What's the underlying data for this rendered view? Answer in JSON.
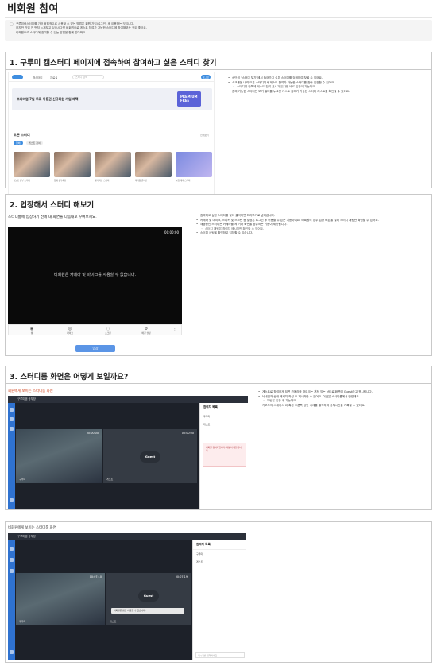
{
  "page": {
    "title": "비회원 참여",
    "callout": [
      "구루미캠스터디를 가장 효율적으로 사용할 수 있는 방법은 회원 가입(로그인) 후 이용하는 것입니다.",
      "하지만 가입 전 먼저 느껴보고 싶으시다면 비회원으로 게스트 참여가 가능한 스터디에 참여해보는 것도 좋아요.",
      "비회원으로 스터디에 참여할 수 있는 방법을 함께 알아봐요."
    ]
  },
  "section1": {
    "heading": "1. 구루미 캠스터디 페이지에 접속하여 참여하고 싶은 스터디 찾기",
    "site": {
      "nav": [
        "캠스터디",
        "자료실"
      ],
      "search_placeholder": "스터디 검색",
      "login": "로그인",
      "banner": "프리미엄 7일 무료 이용권 신규회원 가입 혜택",
      "premium": "PREMIUM FREE",
      "study_heading": "오픈 스터디",
      "study_more": "전체보기",
      "chips": [
        "전체",
        "게스트 참여"
      ],
      "thumb_captions": [
        "오늘도 공부 스터디",
        "함께 공부해요",
        "새벽 기상 스터디",
        "자격증 준비반",
        "시험 대비 스터디"
      ]
    },
    "bullets": [
      "상단의 \"스터디 찾기\"에서 들어가고 싶은 스터디를 검색하여 찾을 수 있어요.",
      "스크롤을 내려 오픈 스터디에서 게스트 참여가 가능한 스터디를 찾아 입장할 수 있어요.",
      "스터디명 안쪽에 게스트 참여 표시가 있다면 바로 입장이 가능해요.",
      "참여 가능한 스터디만 보기 필터를 누르면 게스트 참여가 가능한 스터디 리스트를 확인할 수 있어요."
    ]
  },
  "section2": {
    "heading": "2. 입장해서 스터디 해보기",
    "cam_heading": "스터디룸에 입장하기 전에 내 화면을 다음대로 꾸며보세요.",
    "timer": "00:00:00",
    "camera_msg": "비회원은 카메라 및 마이크를 사용할 수 없습니다.",
    "controls": [
      "캠",
      "마이크",
      "스크린",
      "배경 설정"
    ],
    "enter": "입장",
    "bullets": [
      "참여하고 싶은 스터디를 찾아 클릭하면 미리보기로 넘어갑니다.",
      "카메라 및 마이크, 스피커 및 스크린 등 설정은 로그인 후 이용할 수 있는 기능이에요. 비회원의 경우 입장 버튼을 눌러 스터디 채팅만 확인할 수 있어요.",
      "재생중인 스터디는 카메라를 켜 거나 화면을 공유하는 기능이 제한됩니다.",
      "스터디 채팅은 참여자 메시지만 확인할 수 있어요.",
      "스터디 세팅을 확인하고 입장할 수 있습니다."
    ]
  },
  "section3": {
    "heading": "3. 스터디룸 화면은 어떻게 보일까요?",
    "sublabel": "회원에게 보이는 스터디룸 화면",
    "app_title": "구루미캠 공부방",
    "timer_left": "00:00:00",
    "timer_right": "00:00:00",
    "guest": "Guest",
    "panel_title": "참여자 목록",
    "participants": [
      "구루미",
      "게스트"
    ],
    "warning": "비회원 참여자입니다. 채팅이 제한됩니다.",
    "bullets": [
      "게스트로 참여하게 되면 카메라와 마이크는 꺼져 있는 상태로 화면에 Guest라고 표시됩니다.",
      "닉네임과 상태 메세지 작성 후 재시작할 수 있어요. 이것은 스터디룸에서 반영돼요.",
      "채팅은 입장 후 가능해요.",
      "키보드의 스페이스 바 혹은 오른쪽 상단 시계를 클릭하여 공부시간을 기록할 수 있어요."
    ]
  },
  "section4": {
    "sublabel": "비회원에게 보이는 스터디룸 화면",
    "app_title": "구루미캠 공부방",
    "timer_left": "00:07:10",
    "timer_right": "00:07:19",
    "guest": "Guest",
    "guest_note": "비회원은 캠을 사용할 수 없습니다.",
    "panel_title": "참여자 목록",
    "participants": [
      "구루미",
      "게스트"
    ],
    "chat_placeholder": "메시지를 입력하세요"
  },
  "colors": {
    "accent": "#3f8ee0",
    "dark": "#1d2129",
    "rail": "#2f72d0",
    "warn": "#b23a40"
  }
}
